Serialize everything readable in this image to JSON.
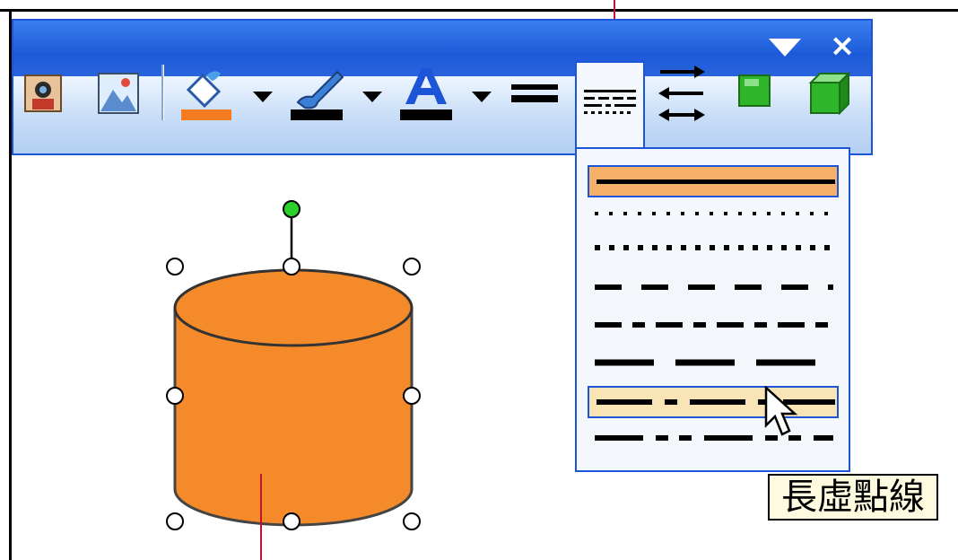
{
  "toolbar": {
    "close_glyph": "×",
    "buttons": [
      {
        "name": "clip-art-icon"
      },
      {
        "name": "insert-picture-icon"
      },
      {
        "name": "fill-color-icon",
        "color": "#f47b20"
      },
      {
        "name": "line-color-icon",
        "color": "#000000"
      },
      {
        "name": "font-color-icon",
        "color": "#000000"
      },
      {
        "name": "line-style-icon"
      },
      {
        "name": "dash-style-icon"
      },
      {
        "name": "arrow-style-icon"
      },
      {
        "name": "shadow-style-icon",
        "color": "#2fb52a"
      },
      {
        "name": "3d-style-icon",
        "color": "#2fb52a"
      }
    ]
  },
  "dash_menu": {
    "items": [
      {
        "style": "solid",
        "state": "selected"
      },
      {
        "style": "round-dot",
        "state": "normal"
      },
      {
        "style": "square-dot",
        "state": "normal"
      },
      {
        "style": "dash",
        "state": "normal"
      },
      {
        "style": "dash-dot",
        "state": "normal"
      },
      {
        "style": "long-dash",
        "state": "normal"
      },
      {
        "style": "long-dash-dot",
        "state": "hover"
      },
      {
        "style": "long-dash-dot-dot",
        "state": "normal"
      }
    ]
  },
  "tooltip": {
    "text": "長虛點線"
  },
  "shape": {
    "type": "cylinder",
    "fill": "#f58a2a"
  },
  "colors": {
    "accent": "#1c55d8",
    "callout": "#c8102e",
    "selected": "#f7b06a",
    "hover": "#f8e4b4"
  }
}
